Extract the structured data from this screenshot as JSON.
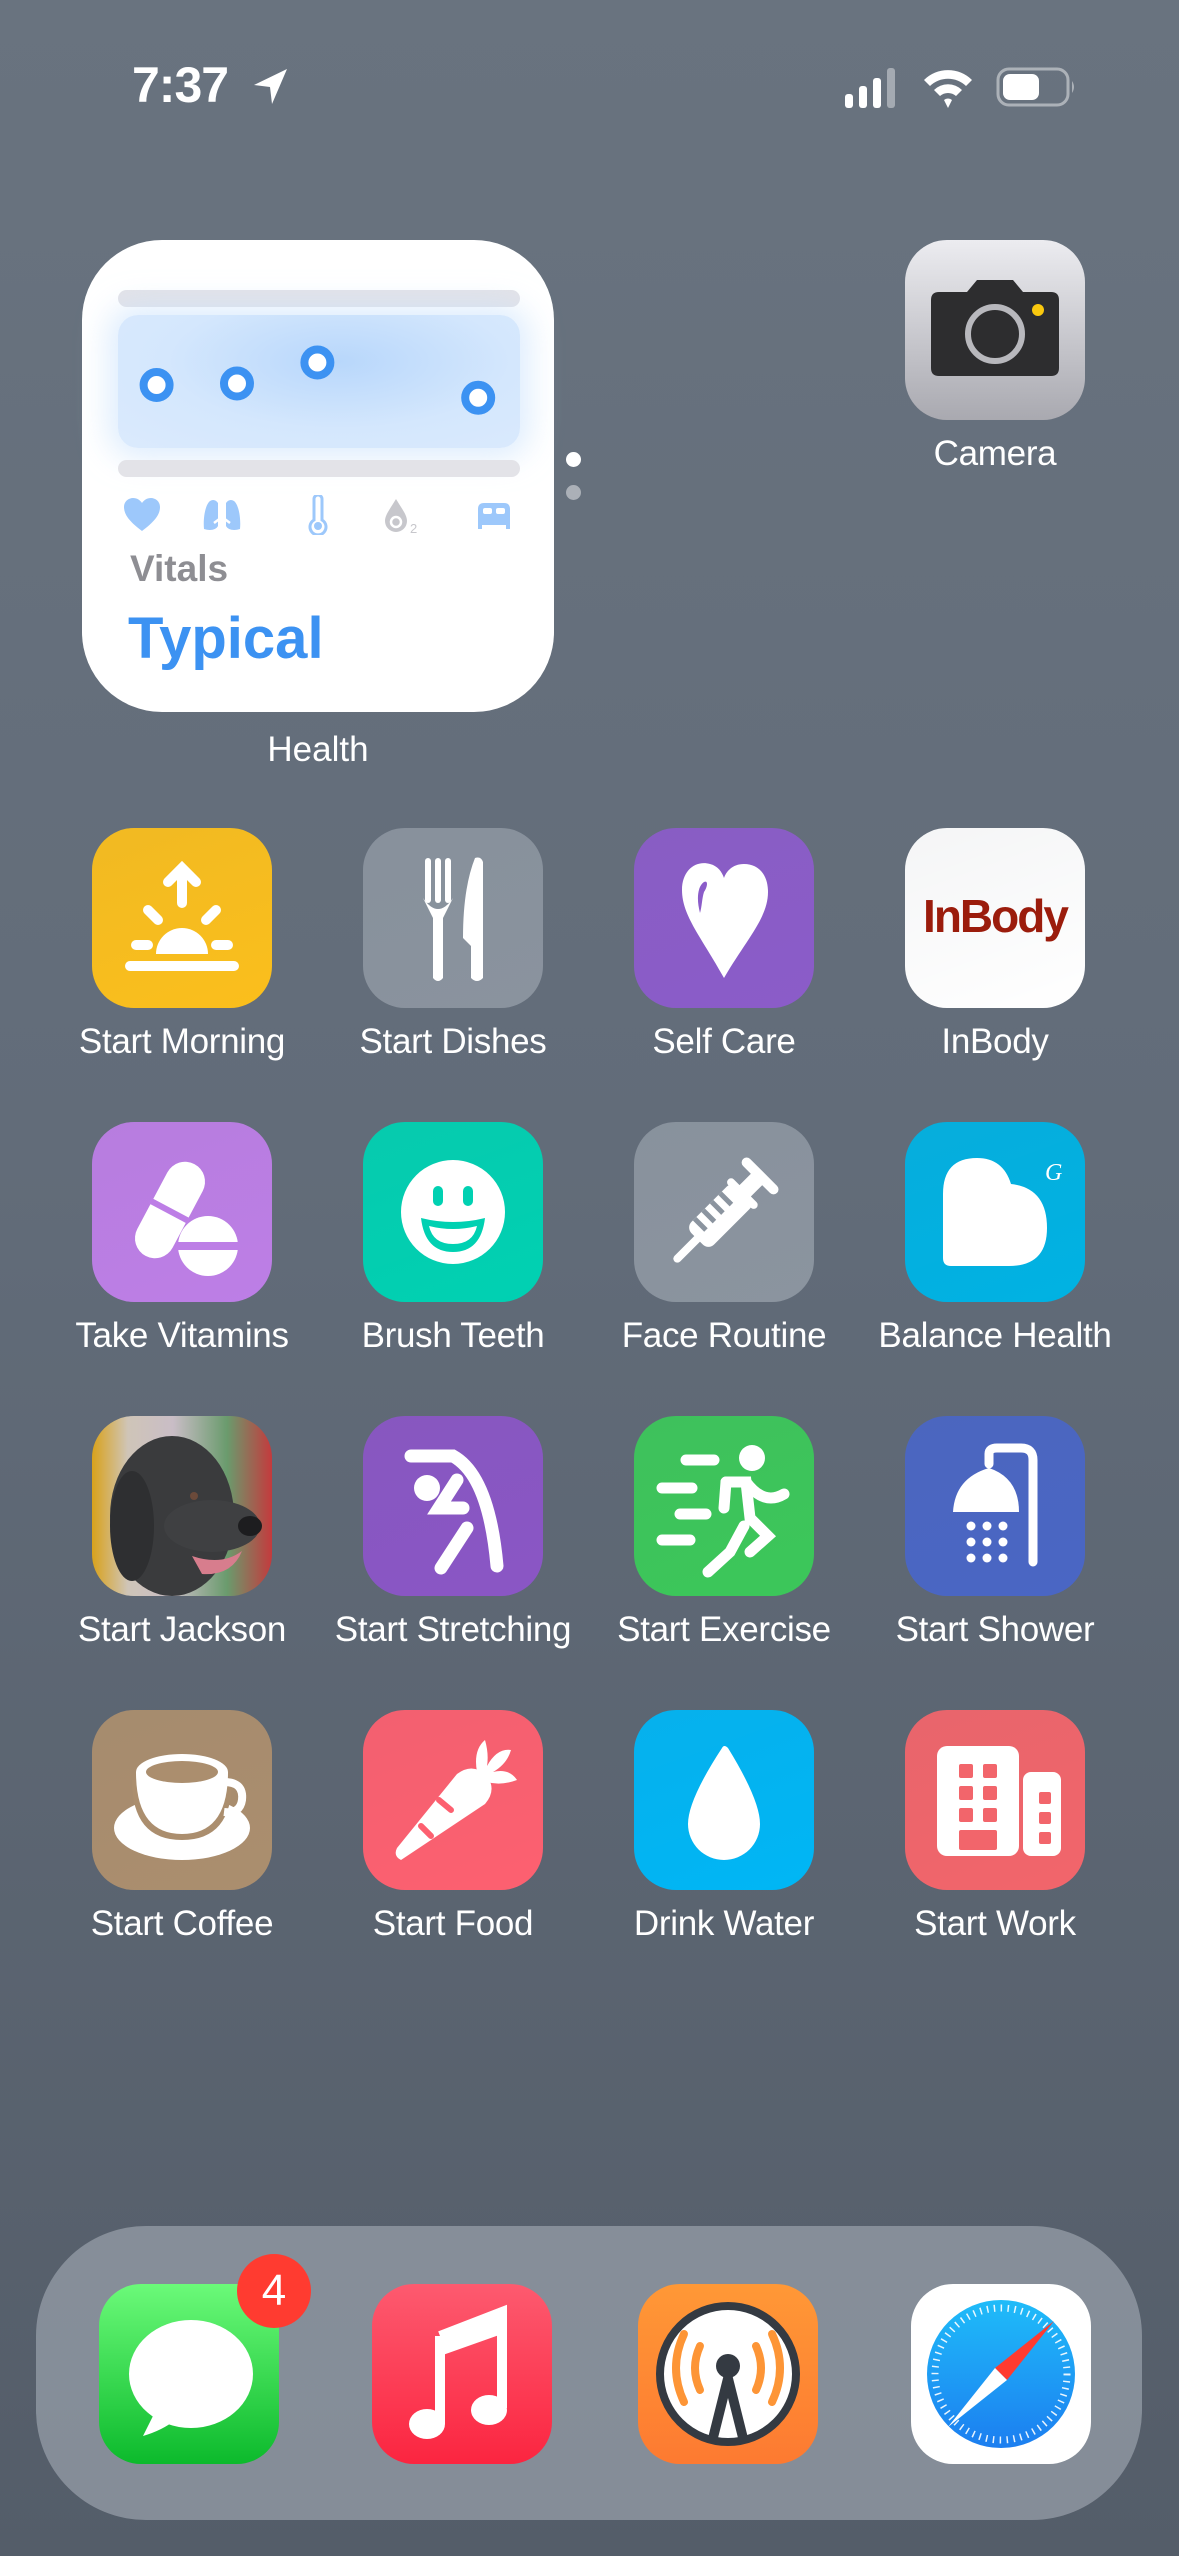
{
  "status_bar": {
    "time": "7:37",
    "location_icon": "location-arrow-icon",
    "signal_icon": "cellular-signal-icon",
    "wifi_icon": "wifi-icon",
    "battery_icon": "battery-icon",
    "battery_level_fraction": 0.6
  },
  "widget": {
    "app_name": "Health",
    "label": "Vitals",
    "value": "Typical",
    "accent_color": "#3c92f2",
    "metrics": [
      {
        "icon": "heart-icon",
        "name": "Heart Rate",
        "status": "typical"
      },
      {
        "icon": "lungs-icon",
        "name": "Respiratory Rate",
        "status": "typical"
      },
      {
        "icon": "thermometer-icon",
        "name": "Temperature",
        "status": "typical"
      },
      {
        "icon": "blood-oxygen-icon",
        "name": "Blood Oxygen",
        "status": "no data"
      },
      {
        "icon": "bed-icon",
        "name": "Sleep",
        "status": "typical"
      }
    ]
  },
  "page_indicator": {
    "pages": 2,
    "current": 1
  },
  "camera": {
    "label": "Camera"
  },
  "apps": [
    {
      "label": "Start Morning",
      "icon": "sunrise-icon",
      "color": "#fbbf1c"
    },
    {
      "label": "Start Dishes",
      "icon": "fork-knife-icon",
      "color": "#8a939e"
    },
    {
      "label": "Self Care",
      "icon": "heart-icon",
      "color": "#8b5cc9"
    },
    {
      "label": "InBody",
      "icon": "inbody-logo-icon",
      "color": "#ffffff",
      "logo_text": "InBody"
    },
    {
      "label": "Take Vitamins",
      "icon": "pills-icon",
      "color": "#bd7ee6"
    },
    {
      "label": "Brush Teeth",
      "icon": "smiley-face-icon",
      "color": "#00d1b2"
    },
    {
      "label": "Face Routine",
      "icon": "syringe-icon",
      "color": "#8b949f"
    },
    {
      "label": "Balance Health",
      "icon": "balance-heart-icon",
      "color": "#00b2e3",
      "logo_text": "G"
    },
    {
      "label": "Start Jackson",
      "icon": "dog-photo-icon",
      "color": "#3b3b3d"
    },
    {
      "label": "Start Stretching",
      "icon": "stretching-figure-icon",
      "color": "#8a56c5"
    },
    {
      "label": "Start Exercise",
      "icon": "running-figure-icon",
      "color": "#3cc75a"
    },
    {
      "label": "Start Shower",
      "icon": "shower-icon",
      "color": "#4a66c4"
    },
    {
      "label": "Start Coffee",
      "icon": "coffee-cup-icon",
      "color": "#ab8e6e"
    },
    {
      "label": "Start Food",
      "icon": "carrot-icon",
      "color": "#fd6070"
    },
    {
      "label": "Drink Water",
      "icon": "water-drop-icon",
      "color": "#00b6f5"
    },
    {
      "label": "Start Work",
      "icon": "building-icon",
      "color": "#f2656b"
    }
  ],
  "dock": [
    {
      "name": "Messages",
      "icon": "messages-icon",
      "badge": "4"
    },
    {
      "name": "Music",
      "icon": "music-note-icon"
    },
    {
      "name": "Overcast",
      "icon": "overcast-tower-icon"
    },
    {
      "name": "Safari",
      "icon": "safari-compass-icon"
    }
  ]
}
